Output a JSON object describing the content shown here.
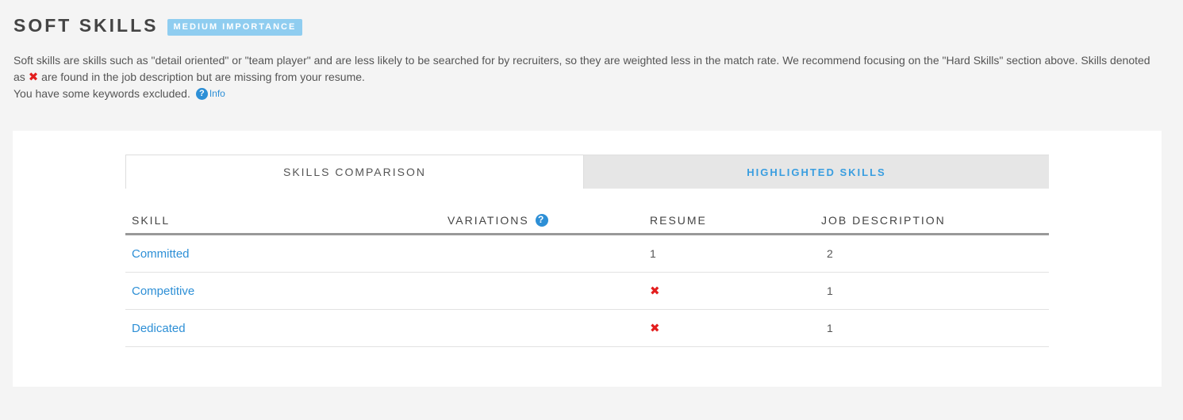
{
  "header": {
    "title": "SOFT SKILLS",
    "badge": "MEDIUM IMPORTANCE"
  },
  "description": {
    "line1": "Soft skills are skills such as \"detail oriented\" or \"team player\" and are less likely to be searched for by recruiters, so they are weighted less in the match rate. We recommend focusing on the \"Hard Skills\" section above. Skills",
    "line2_pre": "denoted as",
    "x_symbol": "✖",
    "line2_post": "are found in the job description but are missing from your resume.",
    "line3": "You have some keywords excluded.",
    "info_label": "Info",
    "help_symbol": "?"
  },
  "tabs": {
    "comparison": "SKILLS COMPARISON",
    "highlighted": "HIGHLIGHTED SKILLS"
  },
  "table": {
    "columns": {
      "skill": "SKILL",
      "variations": "VARIATIONS",
      "resume": "RESUME",
      "job": "JOB DESCRIPTION"
    },
    "rows": [
      {
        "skill": "Committed",
        "resume": "1",
        "job": "2"
      },
      {
        "skill": "Competitive",
        "resume": "✖",
        "job": "1"
      },
      {
        "skill": "Dedicated",
        "resume": "✖",
        "job": "1"
      }
    ]
  },
  "colors": {
    "accent": "#2d8fd6",
    "badge": "#8fcdf0",
    "missing": "#e31e1e"
  }
}
